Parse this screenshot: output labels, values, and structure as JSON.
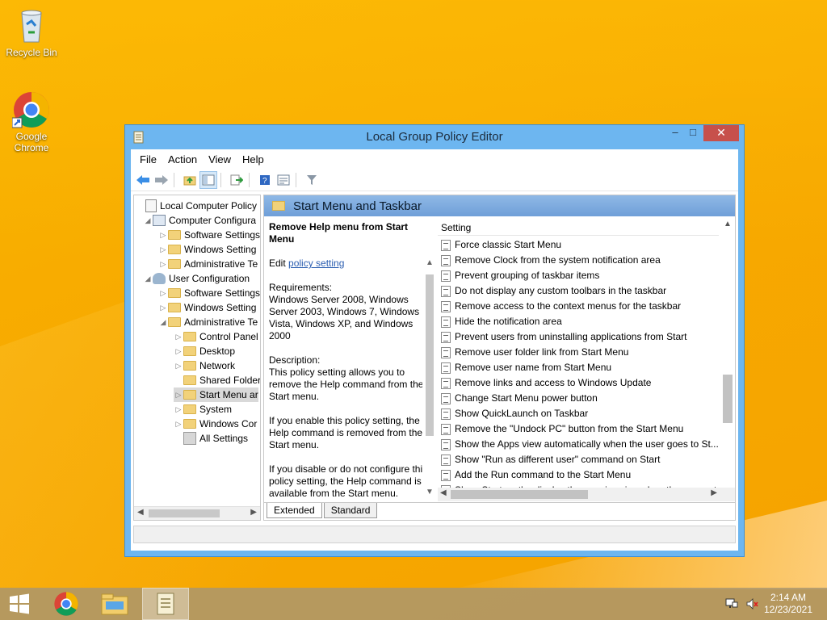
{
  "desktop": {
    "icons": [
      {
        "label": "Recycle Bin"
      },
      {
        "label": "Google Chrome"
      }
    ]
  },
  "window": {
    "title": "Local Group Policy Editor",
    "controls": {
      "minimize": "–",
      "maximize": "□",
      "close": "✕"
    },
    "menu": [
      "File",
      "Action",
      "View",
      "Help"
    ]
  },
  "tree": {
    "items": [
      {
        "label": "Local Computer Policy",
        "indent": 0
      },
      {
        "label": "Computer Configura",
        "indent": 1
      },
      {
        "label": "Software Settings",
        "indent": 2
      },
      {
        "label": "Windows Setting",
        "indent": 2
      },
      {
        "label": "Administrative Te",
        "indent": 2
      },
      {
        "label": "User Configuration",
        "indent": 1
      },
      {
        "label": "Software Settings",
        "indent": 2
      },
      {
        "label": "Windows Setting",
        "indent": 2
      },
      {
        "label": "Administrative Te",
        "indent": 2
      },
      {
        "label": "Control Panel",
        "indent": 3
      },
      {
        "label": "Desktop",
        "indent": 3
      },
      {
        "label": "Network",
        "indent": 3
      },
      {
        "label": "Shared Folder",
        "indent": 3
      },
      {
        "label": "Start Menu ar",
        "indent": 3
      },
      {
        "label": "System",
        "indent": 3
      },
      {
        "label": "Windows Cor",
        "indent": 3
      },
      {
        "label": "All Settings",
        "indent": 3
      }
    ]
  },
  "pane": {
    "header": "Start Menu and Taskbar",
    "desc": {
      "title": "Remove Help menu from Start Menu",
      "edit_prefix": "Edit",
      "edit_link": "policy setting",
      "requirements": "Requirements:",
      "requirements_text": "Windows Server 2008, Windows Server 2003, Windows 7, Windows Vista, Windows XP, and Windows 2000",
      "description": "Description:",
      "p1": "This policy setting allows you to remove the Help command from the Start menu.",
      "p2": "If you enable this policy setting, the Help command is removed from the Start menu.",
      "p3": "If you disable or do not configure this policy setting, the Help command is available from the Start menu."
    },
    "settings_header": "Setting",
    "settings": [
      "Force classic Start Menu",
      "Remove Clock from the system notification area",
      "Prevent grouping of taskbar items",
      "Do not display any custom toolbars in the taskbar",
      "Remove access to the context menus for the taskbar",
      "Hide the notification area",
      "Prevent users from uninstalling applications from Start",
      "Remove user folder link from Start Menu",
      "Remove user name from Start Menu",
      "Remove links and access to Windows Update",
      "Change Start Menu power button",
      "Show QuickLaunch on Taskbar",
      "Remove the \"Undock PC\" button from the Start Menu",
      "Show the Apps view automatically when the user goes to St...",
      "Show \"Run as different user\" command on Start",
      "Add the Run command to the Start Menu",
      "Show Start on the display the user is using when they press t..."
    ],
    "tabs": [
      "Extended",
      "Standard"
    ]
  },
  "taskbar": {
    "time": "2:14 AM",
    "date": "12/23/2021"
  }
}
